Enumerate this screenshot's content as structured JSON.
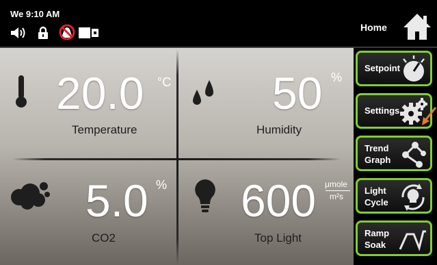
{
  "status": {
    "clock": "We 9:10 AM",
    "icons": [
      "speaker-icon",
      "lock-icon",
      "no-alarm-icon",
      "door-icon"
    ]
  },
  "home": {
    "label": "Home"
  },
  "readings": {
    "temperature": {
      "value": "20.0",
      "unit": "°C",
      "label": "Temperature"
    },
    "humidity": {
      "value": "50",
      "unit": "%",
      "label": "Humidity"
    },
    "co2": {
      "value": "5.0",
      "unit": "%",
      "label": "CO2"
    },
    "light": {
      "value": "600",
      "unit_top": "μmole",
      "unit_bottom": "m²s",
      "label": "Top Light"
    }
  },
  "menu": {
    "setpoint": "Setpoint",
    "settings": "Settings",
    "trend_line1": "Trend",
    "trend_line2": "Graph",
    "light_line1": "Light",
    "light_line2": "Cycle",
    "ramp_line1": "Ramp",
    "ramp_line2": "Soak"
  },
  "colors": {
    "button_border": "#7fcf2f",
    "value_text": "#ffffff",
    "pointer_arrow": "#e8782a"
  }
}
